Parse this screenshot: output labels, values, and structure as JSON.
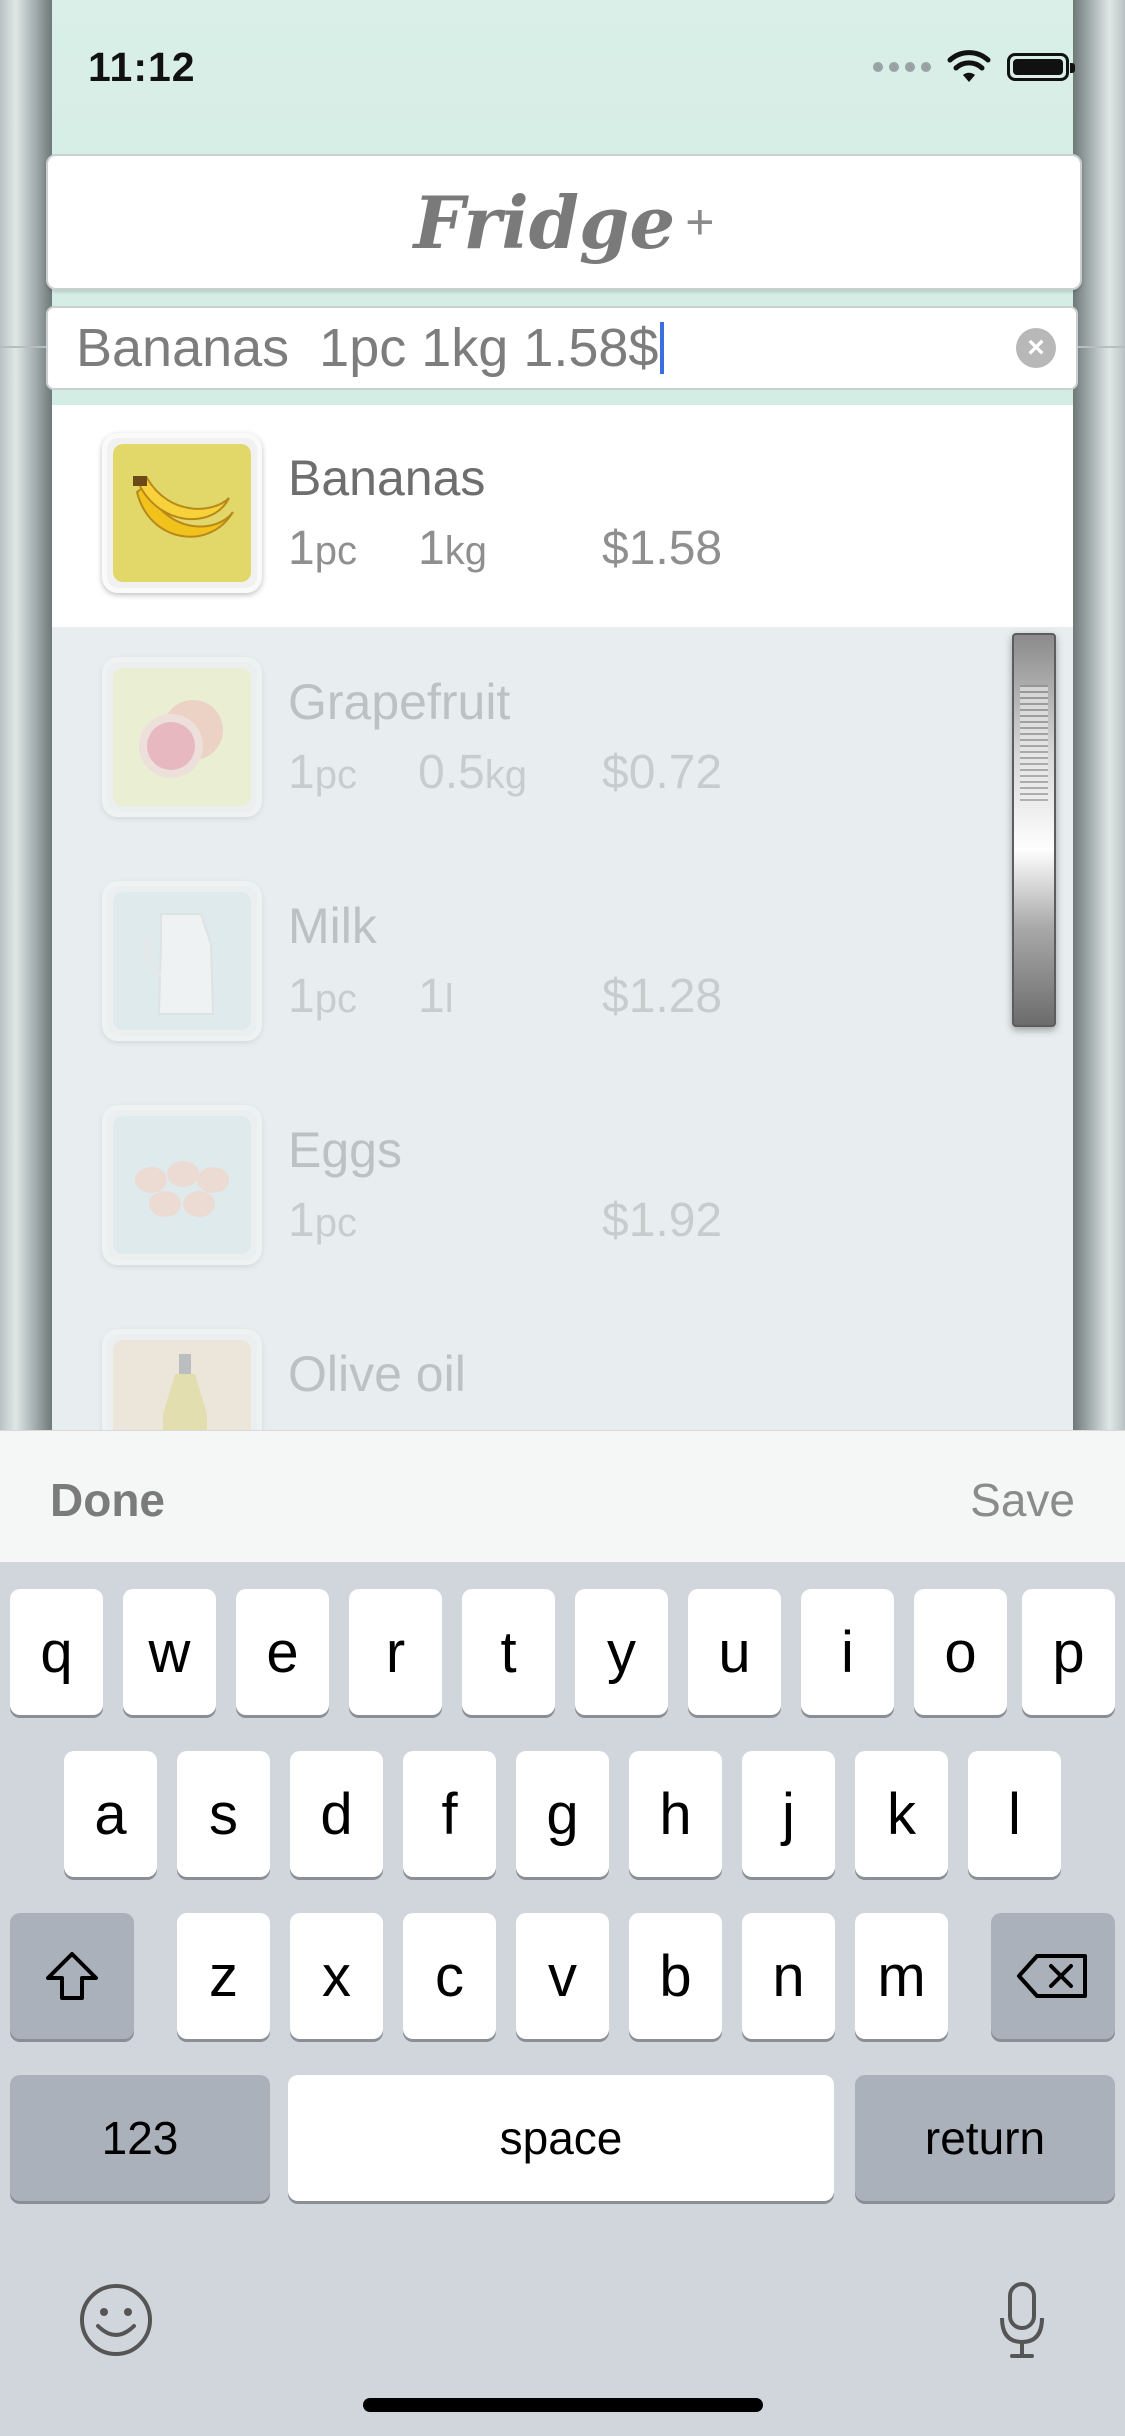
{
  "status_bar": {
    "time": "11:12"
  },
  "header": {
    "logo": "Fridge",
    "logo_plus": "+"
  },
  "search": {
    "value": "Bananas  1pc 1kg 1.58$"
  },
  "items": [
    {
      "name": "Bananas",
      "qty": "1",
      "qty_unit": "pc",
      "weight": "1",
      "weight_unit": "kg",
      "price": "$1.58",
      "icon": "banana-icon",
      "color": "#e2d86a"
    },
    {
      "name": "Grapefruit",
      "qty": "1",
      "qty_unit": "pc",
      "weight": "0.5",
      "weight_unit": "kg",
      "price": "$0.72",
      "icon": "grapefruit-icon",
      "color": "#efef9d"
    },
    {
      "name": "Milk",
      "qty": "1",
      "qty_unit": "pc",
      "weight": "1",
      "weight_unit": "l",
      "price": "$1.28",
      "icon": "milk-icon",
      "color": "#cfe3ea"
    },
    {
      "name": "Eggs",
      "qty": "1",
      "qty_unit": "pc",
      "weight": "",
      "weight_unit": "",
      "price": "$1.92",
      "icon": "eggs-icon",
      "color": "#cfe3ea"
    },
    {
      "name": "Olive oil",
      "qty": "",
      "qty_unit": "",
      "weight": "",
      "weight_unit": "",
      "price": "",
      "icon": "olive-oil-icon",
      "color": "#f5d9b6"
    }
  ],
  "toolbar": {
    "done": "Done",
    "save": "Save"
  },
  "keyboard": {
    "row1": [
      "q",
      "w",
      "e",
      "r",
      "t",
      "y",
      "u",
      "i",
      "o",
      "p"
    ],
    "row2": [
      "a",
      "s",
      "d",
      "f",
      "g",
      "h",
      "j",
      "k",
      "l"
    ],
    "row3": [
      "z",
      "x",
      "c",
      "v",
      "b",
      "n",
      "m"
    ],
    "numbers": "123",
    "space": "space",
    "return": "return"
  }
}
